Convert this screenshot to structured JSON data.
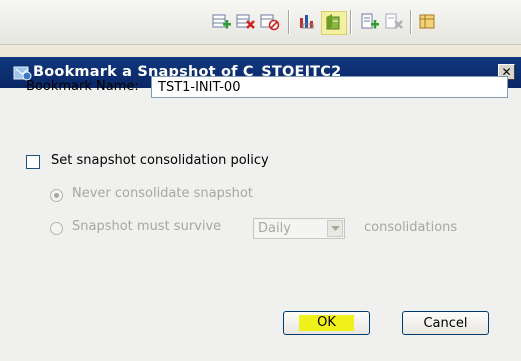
{
  "toolbar": {
    "icons": [
      "add-table-icon",
      "delete-table-icon",
      "disable-icon",
      "chart-icon",
      "bookmark-snapshot-icon",
      "add-item-icon",
      "remove-item-icon",
      "table-icon"
    ]
  },
  "dialog": {
    "title": "Bookmark a Snapshot of  C_STOEITC2",
    "close_label": "✕",
    "bookmark_name_label": "Bookmark Name:",
    "bookmark_name_value": "TST1-INIT-00",
    "policy_checkbox_label": "Set snapshot consolidation policy",
    "policy_checked": false,
    "radio_never_label": "Never consolidate snapshot",
    "radio_survive_label": "Snapshot must survive",
    "survive_select_value": "Daily",
    "consolidations_label": "consolidations",
    "ok_label": "OK",
    "cancel_label": "Cancel"
  },
  "colors": {
    "titlebar": "#0a2665",
    "ok_highlight": "#f0f01a",
    "disabled_text": "#a8a7a0"
  }
}
